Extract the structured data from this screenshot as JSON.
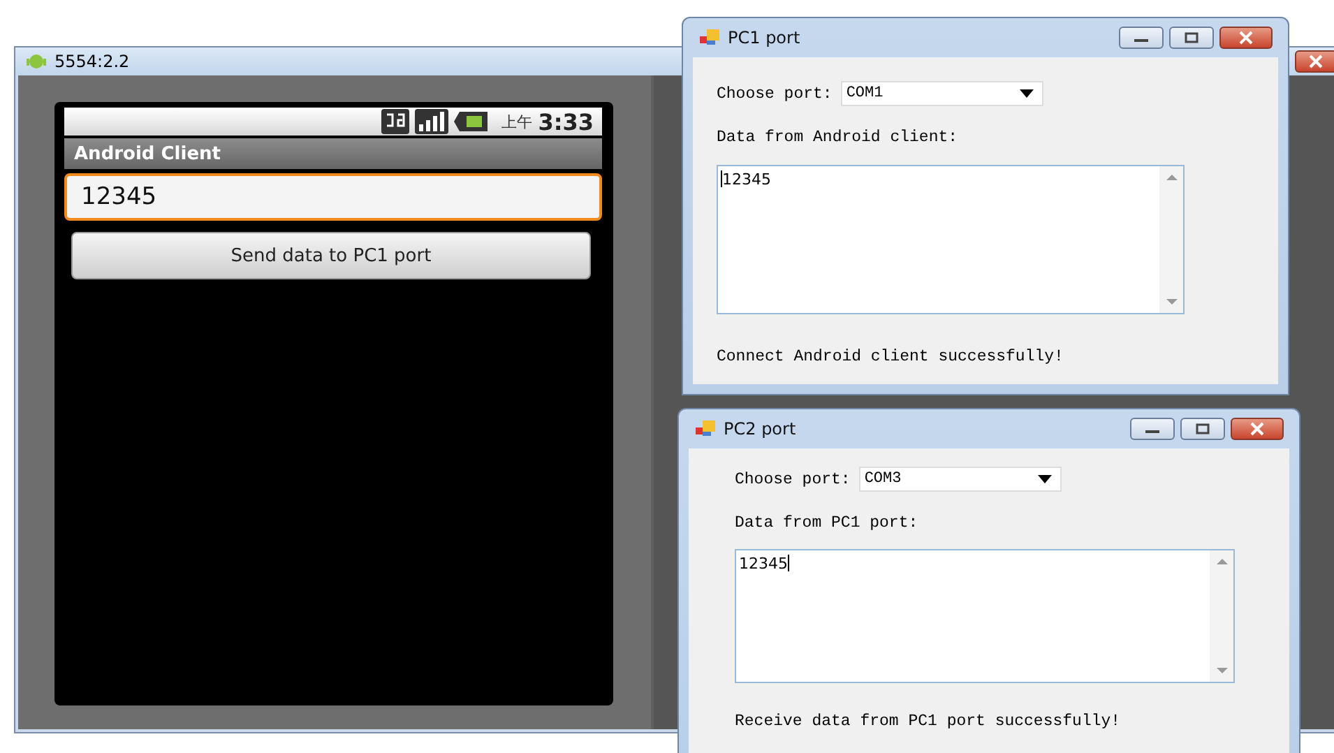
{
  "emulator": {
    "title": "5554:2.2",
    "clock_prefix": "上午",
    "clock": "3:33",
    "app_title": "Android Client",
    "input": {
      "value": "12345",
      "focused": true
    },
    "button": "Send data to PC1 port"
  },
  "windows": [
    {
      "title": "PC1 port",
      "port_label": "Choose port:",
      "port": "COM1",
      "data_label": "Data from Android client:",
      "data": "12345",
      "caret_at_end": false,
      "status": "Connect Android client successfully!"
    },
    {
      "title": "PC2 port",
      "port_label": "Choose port:",
      "port": "COM3",
      "data_label": "Data from PC1 port:",
      "data": "12345",
      "caret_at_end": true,
      "status": "Receive data from PC1 port successfully!"
    }
  ]
}
